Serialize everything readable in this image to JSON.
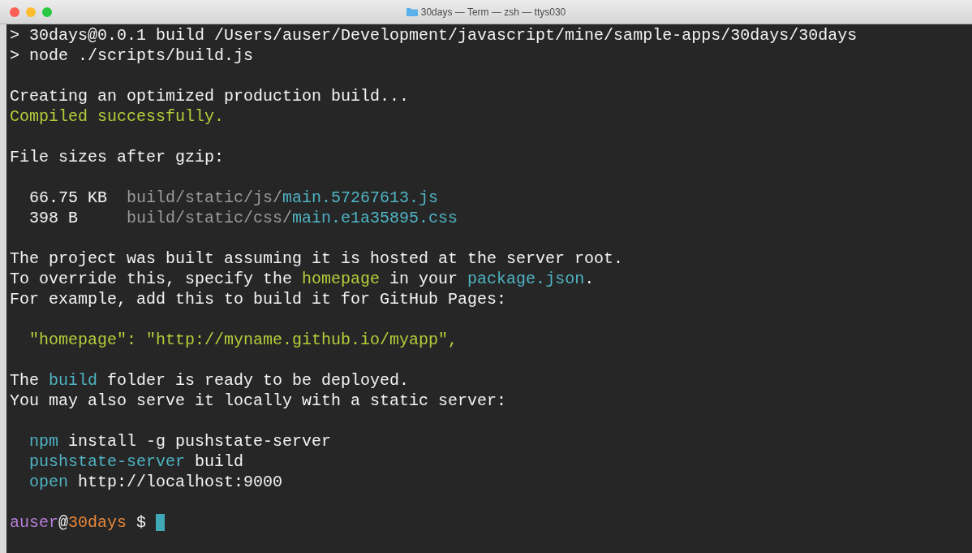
{
  "window": {
    "title": "30days — Term — zsh — ttys030"
  },
  "lines": [
    {
      "kind": "text",
      "segments": [
        {
          "kind": "plain",
          "text": "> 30days@0.0.1 build /Users/auser/Development/javascript/mine/sample-apps/30days/30days"
        }
      ]
    },
    {
      "kind": "text",
      "segments": [
        {
          "kind": "plain",
          "text": "> node ./scripts/build.js"
        }
      ]
    },
    {
      "kind": "blank"
    },
    {
      "kind": "text",
      "segments": [
        {
          "kind": "plain",
          "text": "Creating an optimized production build..."
        }
      ]
    },
    {
      "kind": "text",
      "segments": [
        {
          "kind": "success",
          "text": "Compiled successfully."
        }
      ]
    },
    {
      "kind": "blank"
    },
    {
      "kind": "text",
      "segments": [
        {
          "kind": "plain",
          "text": "File sizes after gzip:"
        }
      ]
    },
    {
      "kind": "blank"
    },
    {
      "kind": "indented",
      "segments": [
        {
          "kind": "plain",
          "text": "66.75 KB  "
        },
        {
          "kind": "dim",
          "text": "build/static/js/"
        },
        {
          "kind": "accent",
          "text": "main.57267613.js"
        }
      ]
    },
    {
      "kind": "indented",
      "segments": [
        {
          "kind": "plain",
          "text": "398 B     "
        },
        {
          "kind": "dim",
          "text": "build/static/css/"
        },
        {
          "kind": "accent",
          "text": "main.e1a35895.css"
        }
      ]
    },
    {
      "kind": "blank"
    },
    {
      "kind": "text",
      "segments": [
        {
          "kind": "plain",
          "text": "The project was built assuming it is hosted at the server root."
        }
      ]
    },
    {
      "kind": "text",
      "segments": [
        {
          "kind": "plain",
          "text": "To override this, specify the "
        },
        {
          "kind": "success",
          "text": "homepage"
        },
        {
          "kind": "plain",
          "text": " in your "
        },
        {
          "kind": "accent",
          "text": "package.json"
        },
        {
          "kind": "plain",
          "text": "."
        }
      ]
    },
    {
      "kind": "text",
      "segments": [
        {
          "kind": "plain",
          "text": "For example, add this to build it for GitHub Pages:"
        }
      ]
    },
    {
      "kind": "blank"
    },
    {
      "kind": "indented",
      "segments": [
        {
          "kind": "success",
          "text": "\"homepage\": \"http://myname.github.io/myapp\","
        }
      ]
    },
    {
      "kind": "blank"
    },
    {
      "kind": "text",
      "segments": [
        {
          "kind": "plain",
          "text": "The "
        },
        {
          "kind": "accent",
          "text": "build"
        },
        {
          "kind": "plain",
          "text": " folder is ready to be deployed."
        }
      ]
    },
    {
      "kind": "text",
      "segments": [
        {
          "kind": "plain",
          "text": "You may also serve it locally with a static server:"
        }
      ]
    },
    {
      "kind": "blank"
    },
    {
      "kind": "indented",
      "segments": [
        {
          "kind": "accent",
          "text": "npm"
        },
        {
          "kind": "plain",
          "text": " install -g pushstate-server"
        }
      ]
    },
    {
      "kind": "indented",
      "segments": [
        {
          "kind": "accent",
          "text": "pushstate-server"
        },
        {
          "kind": "plain",
          "text": " build"
        }
      ]
    },
    {
      "kind": "indented",
      "segments": [
        {
          "kind": "accent",
          "text": "open"
        },
        {
          "kind": "plain",
          "text": " http://localhost:9000"
        }
      ]
    },
    {
      "kind": "blank"
    },
    {
      "kind": "prompt",
      "segments": [
        {
          "kind": "user",
          "text": "auser"
        },
        {
          "kind": "plain",
          "text": "@"
        },
        {
          "kind": "host",
          "text": "30days"
        },
        {
          "kind": "plain",
          "text": " $ "
        }
      ]
    }
  ]
}
